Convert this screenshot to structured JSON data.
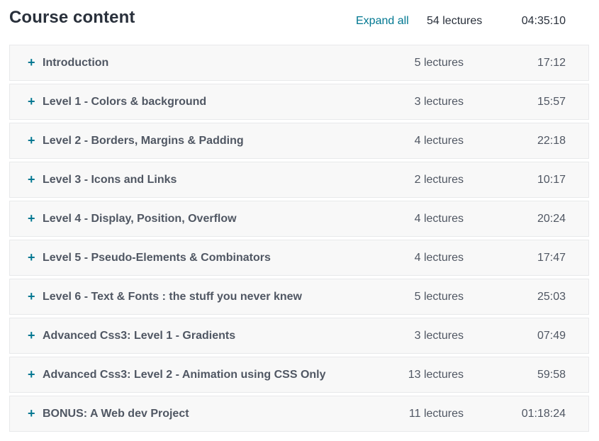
{
  "header": {
    "title": "Course content",
    "expand_all_label": "Expand all",
    "total_lectures": "54 lectures",
    "total_duration": "04:35:10"
  },
  "icons": {
    "expand": "plus-icon"
  },
  "colors": {
    "accent": "#007791",
    "text": "#29303b",
    "muted_text": "#505763",
    "section_bg": "#f8f8f8",
    "border": "#e8e9eb"
  },
  "sections": [
    {
      "title": "Introduction",
      "lectures": "5 lectures",
      "duration": "17:12"
    },
    {
      "title": "Level 1 - Colors & background",
      "lectures": "3 lectures",
      "duration": "15:57"
    },
    {
      "title": "Level 2 - Borders, Margins & Padding",
      "lectures": "4 lectures",
      "duration": "22:18"
    },
    {
      "title": "Level 3 - Icons and Links",
      "lectures": "2 lectures",
      "duration": "10:17"
    },
    {
      "title": "Level 4 - Display, Position, Overflow",
      "lectures": "4 lectures",
      "duration": "20:24"
    },
    {
      "title": "Level 5 - Pseudo-Elements & Combinators",
      "lectures": "4 lectures",
      "duration": "17:47"
    },
    {
      "title": "Level 6 - Text & Fonts : the stuff you never knew",
      "lectures": "5 lectures",
      "duration": "25:03"
    },
    {
      "title": "Advanced Css3: Level 1 - Gradients",
      "lectures": "3 lectures",
      "duration": "07:49"
    },
    {
      "title": "Advanced Css3: Level 2 - Animation using CSS Only",
      "lectures": "13 lectures",
      "duration": "59:58"
    },
    {
      "title": "BONUS: A Web dev Project",
      "lectures": "11 lectures",
      "duration": "01:18:24"
    }
  ]
}
